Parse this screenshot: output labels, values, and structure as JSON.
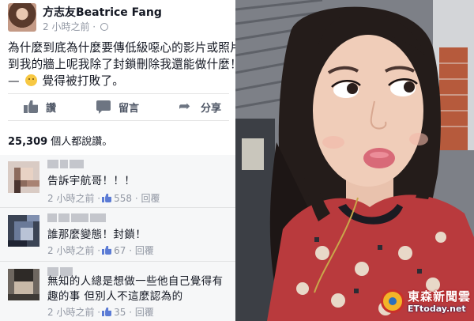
{
  "post": {
    "author_name": "方志友Beatrice Fang",
    "timestamp": "2 小時之前 ·",
    "text_lines": [
      "為什麼到底為什麼要傳低級噁心的影片或照片",
      "到我的牆上呢我除了封鎖刪除我還能做什麼！"
    ],
    "feeling_prefix": "—",
    "feeling_text": "覺得被打敗了。",
    "actions": {
      "like": "讚",
      "comment": "留言",
      "share": "分享"
    },
    "like_count": "25,309",
    "like_summary_suffix": " 個人都說讚。"
  },
  "comments": [
    {
      "text": "告訴宇航哥！！！",
      "time": "2 小時之前 ·",
      "likes": "558",
      "reply": "回覆"
    },
    {
      "text": "誰那麼變態！封鎖！",
      "time": "2 小時之前 ·",
      "likes": "67",
      "reply": "回覆"
    },
    {
      "text": "無知的人總是想做一些他自己覺得有趣的事 但別人不這麼認為的",
      "time": "2 小時之前 ·",
      "likes": "35",
      "reply": "回覆"
    }
  ],
  "watermark": {
    "title": "東森新聞雲",
    "url": "ETtoday.net"
  },
  "colors": {
    "fb_text": "#141823",
    "fb_meta": "#9197a3",
    "like_blue": "#5b7bd5",
    "comment_bg": "#f6f7f8"
  },
  "icons": [
    "globe-icon",
    "like-icon",
    "comment-icon",
    "share-icon",
    "mini-like-icon"
  ]
}
